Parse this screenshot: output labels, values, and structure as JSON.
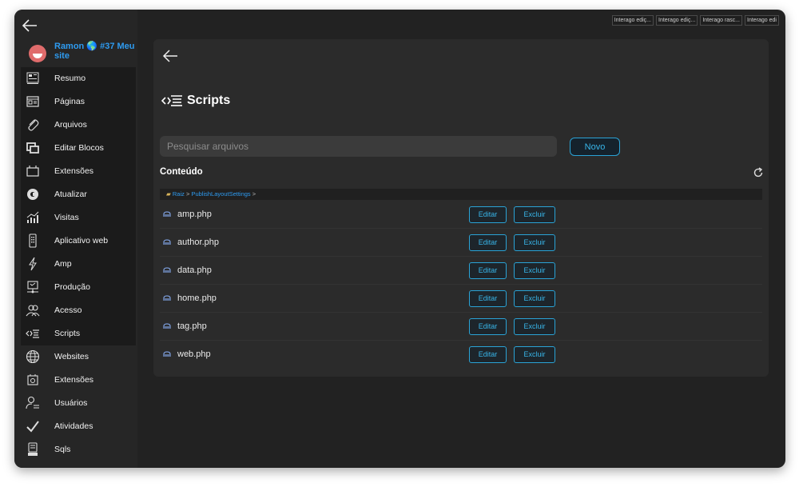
{
  "tabs": [
    "Interago ediç...",
    "Interago ediç...",
    "Interago rasc...",
    "Interago edi"
  ],
  "site": {
    "name": "Ramon 🌎 #37 Meu site"
  },
  "sidebar": {
    "items": [
      {
        "label": "Resumo",
        "icon": "dashboard-icon"
      },
      {
        "label": "Páginas",
        "icon": "pages-icon"
      },
      {
        "label": "Arquivos",
        "icon": "paperclip-icon"
      },
      {
        "label": "Editar Blocos",
        "icon": "blocks-icon"
      },
      {
        "label": "Extensões",
        "icon": "extensions-icon"
      },
      {
        "label": "Atualizar",
        "icon": "update-icon"
      },
      {
        "label": "Visitas",
        "icon": "visits-chart-icon"
      },
      {
        "label": "Aplicativo web",
        "icon": "mobile-app-icon"
      },
      {
        "label": "Amp",
        "icon": "lightning-icon"
      },
      {
        "label": "Produção",
        "icon": "production-icon"
      },
      {
        "label": "Acesso",
        "icon": "users-access-icon"
      },
      {
        "label": "Scripts",
        "icon": "code-icon"
      },
      {
        "label": "Websites",
        "icon": "globe-icon"
      },
      {
        "label": "Extensões",
        "icon": "extensions-gear-icon"
      },
      {
        "label": "Usuários",
        "icon": "user-list-icon"
      },
      {
        "label": "Atividades",
        "icon": "check-icon"
      },
      {
        "label": "Sqls",
        "icon": "database-icon"
      }
    ]
  },
  "page": {
    "title": "Scripts",
    "search_placeholder": "Pesquisar arquivos",
    "new_label": "Novo",
    "section_title": "Conteúdo",
    "breadcrumb": {
      "root": "Raiz",
      "sep1": " > ",
      "folder": "PublishLayoutSettings",
      "sep2": " >"
    }
  },
  "files": [
    {
      "name": "amp.php",
      "edit": "Editar",
      "delete": "Excluir"
    },
    {
      "name": "author.php",
      "edit": "Editar",
      "delete": "Excluir"
    },
    {
      "name": "data.php",
      "edit": "Editar",
      "delete": "Excluir"
    },
    {
      "name": "home.php",
      "edit": "Editar",
      "delete": "Excluir"
    },
    {
      "name": "tag.php",
      "edit": "Editar",
      "delete": "Excluir"
    },
    {
      "name": "web.php",
      "edit": "Editar",
      "delete": "Excluir"
    }
  ],
  "colors": {
    "accent": "#2e9bf0",
    "button_border": "#2aa3d6",
    "panel": "#2b2b2b",
    "window": "#222222"
  }
}
